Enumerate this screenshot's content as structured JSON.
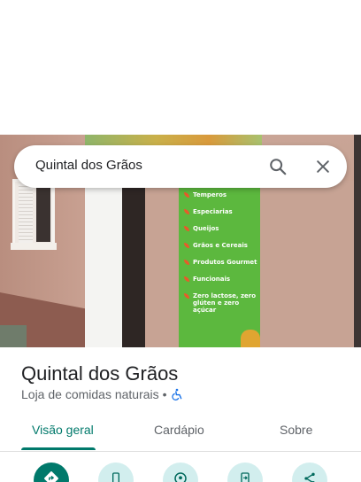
{
  "search": {
    "query": "Quintal dos Grãos",
    "search_icon": "search-icon",
    "close_icon": "close-icon"
  },
  "photo": {
    "banner_items": [
      "Temperos",
      "Especiarias",
      "Queijos",
      "Grãos e Cereais",
      "Produtos Gourmet",
      "Funcionais",
      "Zero lactose, zero glúten e zero açúcar"
    ]
  },
  "place": {
    "title": "Quintal dos Grãos",
    "category": "Loja de comidas naturais",
    "separator": "•",
    "accessibility_icon": "wheelchair-icon"
  },
  "tabs": [
    {
      "label": "Visão geral",
      "active": true
    },
    {
      "label": "Cardápio",
      "active": false
    },
    {
      "label": "Sobre",
      "active": false
    }
  ],
  "actions": [
    {
      "icon": "directions-icon"
    },
    {
      "icon": "phone-icon"
    },
    {
      "icon": "nearby-icon"
    },
    {
      "icon": "send-to-phone-icon"
    },
    {
      "icon": "share-icon"
    }
  ],
  "colors": {
    "accent": "#00796b",
    "action_bg": "#d2eeee",
    "banner_green": "#5cb83e"
  }
}
